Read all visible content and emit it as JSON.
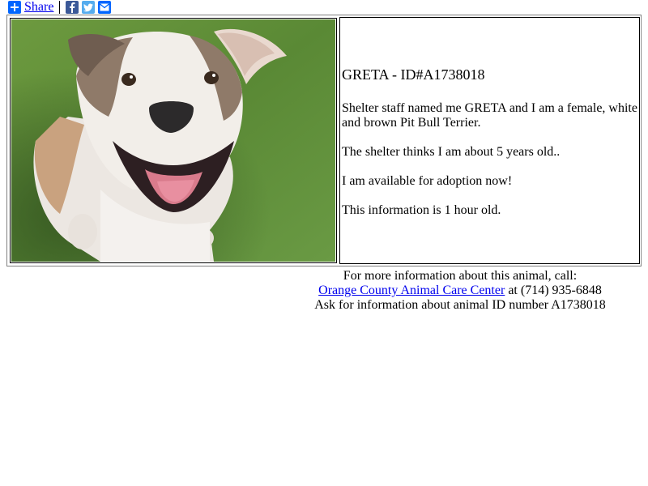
{
  "share": {
    "label": "Share",
    "icons": [
      "plus-icon",
      "facebook-icon",
      "twitter-icon",
      "email-icon"
    ],
    "colors": {
      "share": "#0166ff",
      "facebook": "#3b5998",
      "twitter": "#55acee",
      "email": "#0166ff"
    }
  },
  "animal": {
    "heading": "GRETA - ID#A1738018",
    "description": "Shelter staff named me GRETA and I am a female, white and brown Pit Bull Terrier.",
    "age": "The shelter thinks I am about 5 years old..",
    "availability": "I am available for adoption now!",
    "freshness": "This information is 1 hour old."
  },
  "contact": {
    "line1": "For more information about this animal, call:",
    "shelter_link": "Orange County Animal Care Center",
    "at_text": " at ",
    "phone": "(714) 935-6848",
    "line3": "Ask for information about animal ID number A1738018"
  },
  "colors": {
    "link": "#0000ee",
    "grass": "#5c8a3a"
  }
}
